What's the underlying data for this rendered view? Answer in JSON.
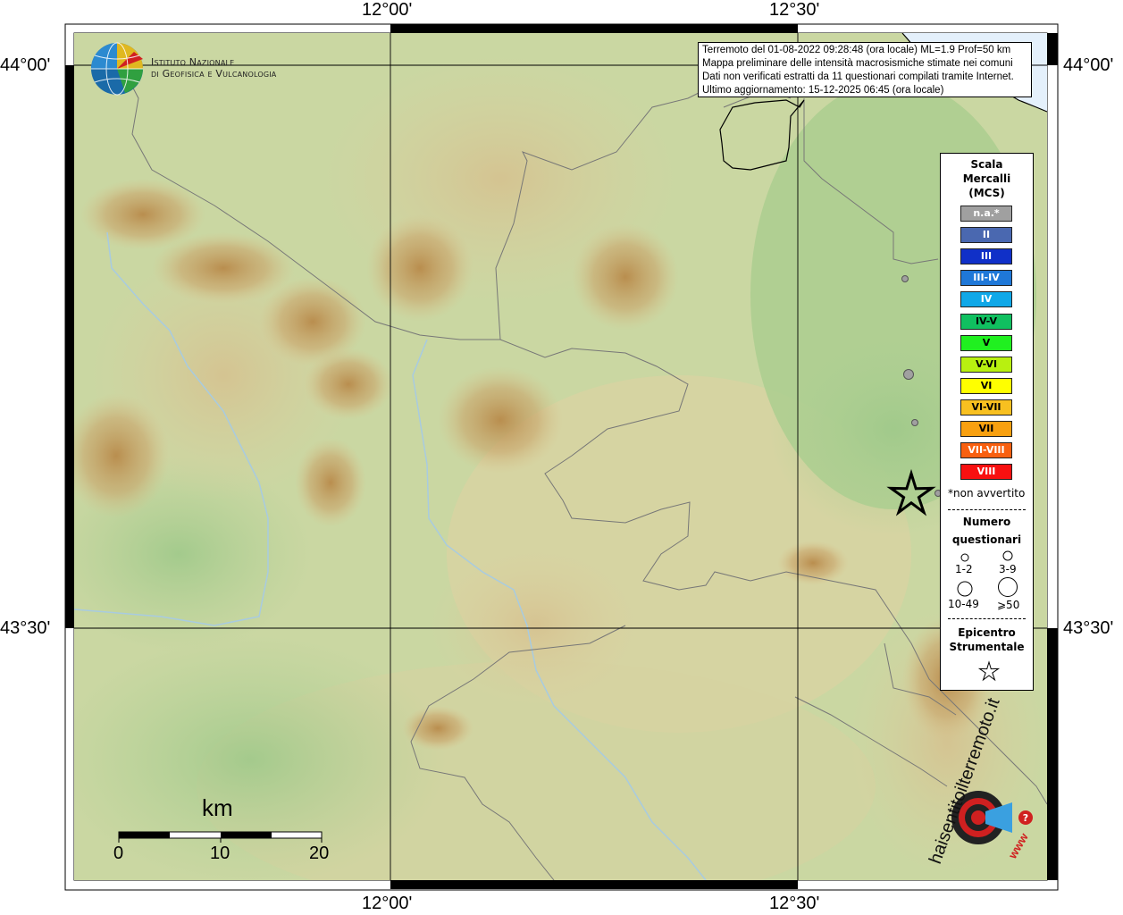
{
  "map": {
    "ticks": {
      "top": [
        "12°00'",
        "12°30'"
      ],
      "bottom": [
        "12°00'",
        "12°30'"
      ],
      "left": [
        "44°00'",
        "43°30'"
      ],
      "right": [
        "44°00'",
        "43°30'"
      ]
    },
    "info_lines": [
      "Terremoto del 01-08-2022 09:28:48 (ora locale) ML=1.9 Prof=50 km",
      "Mappa preliminare delle intensità macrosismiche stimate nei comuni",
      "Dati non verificati estratti da 11 questionari compilati tramite Internet.",
      "Ultimo aggiornamento: 15-12-2025 06:45 (ora locale)"
    ],
    "ingv_logo": {
      "line1": "Istituto Nazionale",
      "line2": "di Geofisica e Vulcanologia"
    },
    "scalebar": {
      "unit": "km",
      "labels": [
        "0",
        "10",
        "20"
      ]
    },
    "watermark": {
      "text1": "haisentitoilterremoto.it",
      "text2": "www"
    }
  },
  "legend": {
    "title_lines": [
      "Scala",
      "Mercalli",
      "(MCS)"
    ],
    "classes": [
      {
        "label": "n.a.*",
        "color": "#a0a0a0",
        "text_color": "#ffffff"
      },
      {
        "label": "II",
        "color": "#4a68b0",
        "text_color": "#ffffff"
      },
      {
        "label": "III",
        "color": "#1030c8",
        "text_color": "#ffffff"
      },
      {
        "label": "III-IV",
        "color": "#1f78d8",
        "text_color": "#ffffff"
      },
      {
        "label": "IV",
        "color": "#10a8e8",
        "text_color": "#ffffff"
      },
      {
        "label": "IV-V",
        "color": "#10c060",
        "text_color": "#000000"
      },
      {
        "label": "V",
        "color": "#20f020",
        "text_color": "#000000"
      },
      {
        "label": "V-VI",
        "color": "#b8f010",
        "text_color": "#000000"
      },
      {
        "label": "VI",
        "color": "#ffff00",
        "text_color": "#000000"
      },
      {
        "label": "VI-VII",
        "color": "#f8c020",
        "text_color": "#000000"
      },
      {
        "label": "VII",
        "color": "#f8a010",
        "text_color": "#000000"
      },
      {
        "label": "VII-VIII",
        "color": "#f86010",
        "text_color": "#ffffff"
      },
      {
        "label": "VIII",
        "color": "#f81010",
        "text_color": "#ffffff"
      }
    ],
    "na_note": "*non avvertito",
    "count_title_lines": [
      "Numero",
      "questionari"
    ],
    "count_classes": [
      "1-2",
      "3-9",
      "10-49",
      "⩾50"
    ],
    "epicenter_title_lines": [
      "Epicentro",
      "Strumentale"
    ]
  }
}
